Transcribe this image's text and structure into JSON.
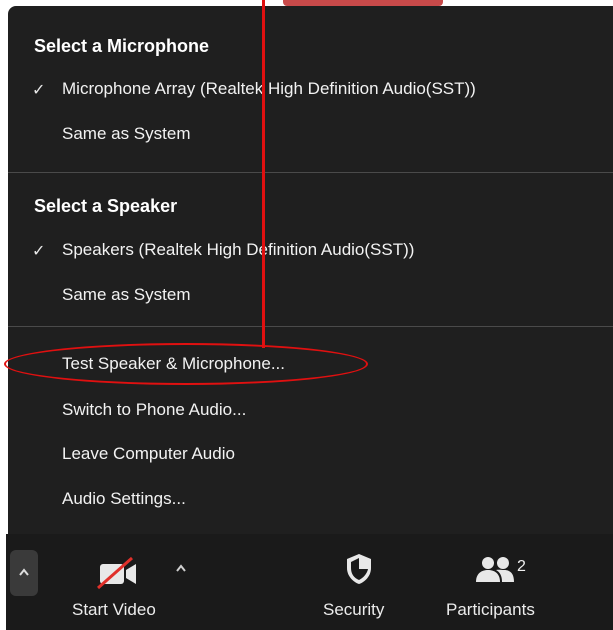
{
  "microphone": {
    "heading": "Select a Microphone",
    "items": [
      {
        "label": "Microphone Array (Realtek High Definition Audio(SST))",
        "checked": true
      },
      {
        "label": "Same as System",
        "checked": false
      }
    ]
  },
  "speaker": {
    "heading": "Select a Speaker",
    "items": [
      {
        "label": "Speakers (Realtek High Definition Audio(SST))",
        "checked": true
      },
      {
        "label": "Same as System",
        "checked": false
      }
    ]
  },
  "actions": [
    {
      "label": "Test Speaker & Microphone..."
    },
    {
      "label": "Switch to Phone Audio..."
    },
    {
      "label": "Leave Computer Audio"
    },
    {
      "label": "Audio Settings..."
    }
  ],
  "check_mark": "✓",
  "toolbar": {
    "start_video": "Start Video",
    "security": "Security",
    "participants": "Participants",
    "participant_count": "2"
  },
  "colors": {
    "menu_bg": "#1f1f1f",
    "annotation": "#e01010",
    "video_slash": "#e0302a"
  }
}
